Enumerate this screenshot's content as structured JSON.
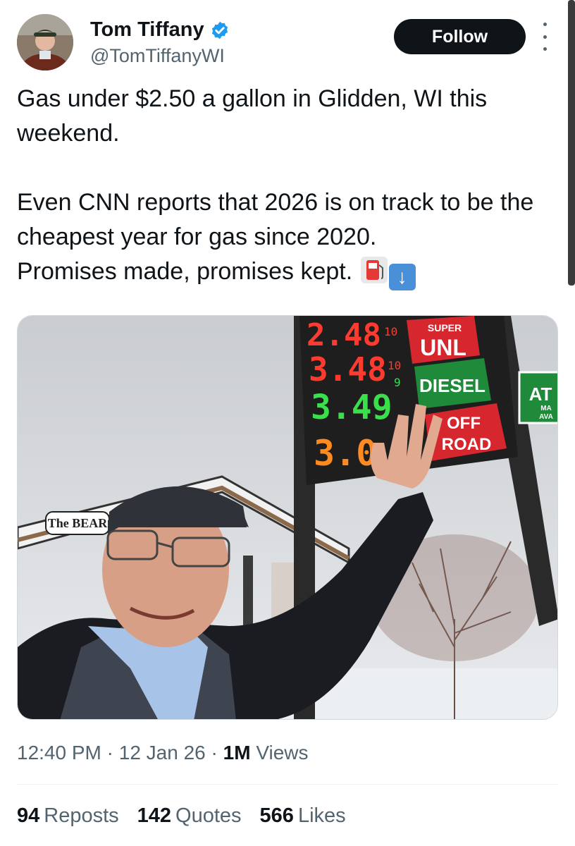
{
  "author": {
    "display_name": "Tom Tiffany",
    "handle": "@TomTiffanyWI",
    "verified": true
  },
  "actions": {
    "follow_label": "Follow",
    "more_icon": "more-vertical-icon"
  },
  "tweet": {
    "lines": [
      "Gas under $2.50 a gallon in Glidden, WI this weekend.",
      "Even CNN reports that 2026 is on track to be the cheapest year for gas since 2020.",
      "Promises made, promises kept."
    ],
    "emojis": [
      "fuel-pump-emoji",
      "down-arrow-emoji"
    ]
  },
  "photo": {
    "prices": [
      "2.48",
      "3.48",
      "3.49",
      "3.0"
    ],
    "price_fractions": [
      "10",
      "10",
      "9"
    ],
    "signs": {
      "super": "SUPER",
      "unl": "UNL",
      "diesel": "DIESEL",
      "off": "OFF",
      "road": "ROAD"
    },
    "canopy_text": "The BEAR",
    "side_sign": "AT",
    "side_sign_small": [
      "MA",
      "AVA"
    ]
  },
  "meta": {
    "time": "12:40 PM",
    "date": "12 Jan 26",
    "separator": "·",
    "views_count": "1M",
    "views_label": "Views"
  },
  "stats": {
    "reposts": {
      "count": "94",
      "label": "Reposts"
    },
    "quotes": {
      "count": "142",
      "label": "Quotes"
    },
    "likes": {
      "count": "566",
      "label": "Likes"
    }
  },
  "colors": {
    "follow_bg": "#0f1419",
    "verified": "#1d9bf0",
    "secondary_text": "#536471",
    "price_red": "#ff3b2f",
    "price_green": "#39e04a",
    "price_orange": "#ff8a1f"
  }
}
